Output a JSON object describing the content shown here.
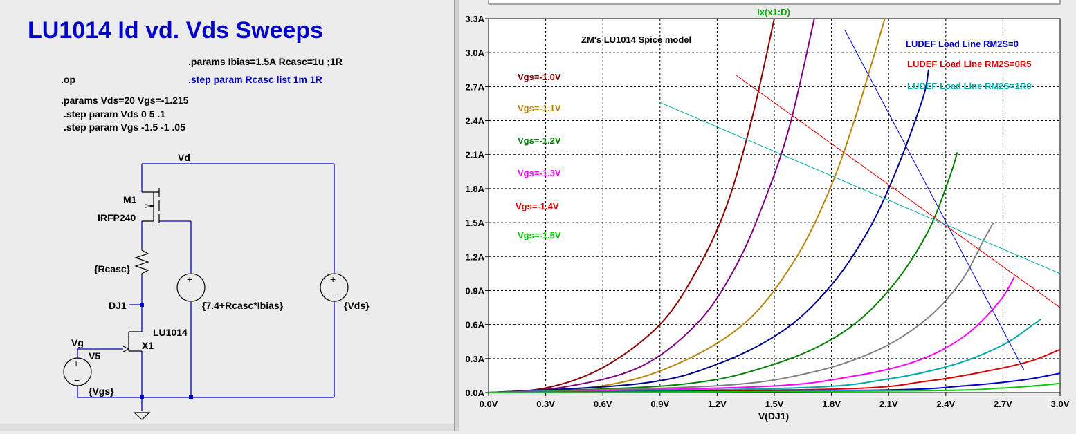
{
  "schematic": {
    "title": "LU1014 Id vd. Vds Sweeps",
    "title_color": "#0000cc",
    "directives": {
      "params_ibias": ".params Ibias=1.5A Rcasc=1u ;1R",
      "op": ".op",
      "step_rcasc": ".step param Rcasc list 1m 1R",
      "params_vds": ".params Vds=20 Vgs=-1.215",
      "step_vds": ".step param Vds 0 5 .1",
      "step_vgs": ".step param Vgs -1.5 -1 .05"
    },
    "labels": {
      "vd_net": "Vd",
      "m1_name": "M1",
      "m1_model": "IRFP240",
      "rcasc": "{Rcasc}",
      "dj1_net": "DJ1",
      "x1_model": "LU1014",
      "x1_name": "X1",
      "vg_net": "Vg",
      "v5_name": "V5",
      "v5_value": "{Vgs}",
      "vsrc_mid": "{7.4+Rcasc*Ibias}",
      "vsrc_right": "{Vds}",
      "plus_sign": "+",
      "minus_sign": "−"
    },
    "wire_color": "#0000cc"
  },
  "plot": {
    "trace_label": "Ix(x1:D)",
    "trace_label_color": "#00aa00",
    "model_title": "ZM's LU1014 Spice model",
    "x_axis_label": "V(DJ1)",
    "legend": [
      {
        "text": "LUDEF Load Line RM2S=0",
        "color": "#0000cc"
      },
      {
        "text": "LUDEF Load Line RM2S=0R5",
        "color": "#dd0000"
      },
      {
        "text": "LUDEF Load Line RM2S=1R0",
        "color": "#00aaaa"
      }
    ],
    "vgs_labels": [
      {
        "text": "Vgs=-1.0V",
        "color": "#8b0000"
      },
      {
        "text": "Vgs=-1.1V",
        "color": "#b8860b"
      },
      {
        "text": "Vgs=-1.2V",
        "color": "#008000"
      },
      {
        "text": "Vgs=-1.3V",
        "color": "#ff00ff"
      },
      {
        "text": "Vgs=-1.4V",
        "color": "#dd0000"
      },
      {
        "text": "Vgs=-1.5V",
        "color": "#00cc00"
      }
    ]
  },
  "chart_data": {
    "type": "line",
    "title": "ZM's LU1014 Spice model",
    "xlabel": "V(DJ1)",
    "ylabel": "",
    "xlim": [
      0,
      3.0
    ],
    "ylim": [
      0,
      3.3
    ],
    "x_ticks": [
      "0.0V",
      "0.3V",
      "0.6V",
      "0.9V",
      "1.2V",
      "1.5V",
      "1.8V",
      "2.1V",
      "2.4V",
      "2.7V",
      "3.0V"
    ],
    "y_ticks": [
      "0.0A",
      "0.3A",
      "0.6A",
      "0.9A",
      "1.2A",
      "1.5A",
      "1.8A",
      "2.1A",
      "2.4A",
      "2.7A",
      "3.0A",
      "3.3A"
    ],
    "grid": true,
    "series": [
      {
        "color": "#8b0000",
        "points": [
          [
            0,
            0
          ],
          [
            0.3,
            0.04
          ],
          [
            0.6,
            0.22
          ],
          [
            0.9,
            0.6
          ],
          [
            1.1,
            1.1
          ],
          [
            1.25,
            1.65
          ],
          [
            1.38,
            2.4
          ],
          [
            1.5,
            3.3
          ]
        ]
      },
      {
        "color": "#800080",
        "points": [
          [
            0,
            0
          ],
          [
            0.4,
            0.05
          ],
          [
            0.8,
            0.23
          ],
          [
            1.1,
            0.62
          ],
          [
            1.3,
            1.12
          ],
          [
            1.45,
            1.7
          ],
          [
            1.58,
            2.35
          ],
          [
            1.71,
            3.3
          ]
        ]
      },
      {
        "color": "#b8860b",
        "points": [
          [
            0,
            0
          ],
          [
            0.6,
            0.06
          ],
          [
            1.0,
            0.26
          ],
          [
            1.35,
            0.62
          ],
          [
            1.6,
            1.15
          ],
          [
            1.78,
            1.75
          ],
          [
            1.92,
            2.4
          ],
          [
            2.08,
            3.3
          ]
        ]
      },
      {
        "color": "#00008b",
        "points": [
          [
            0,
            0
          ],
          [
            0.8,
            0.08
          ],
          [
            1.2,
            0.25
          ],
          [
            1.55,
            0.55
          ],
          [
            1.8,
            0.95
          ],
          [
            2.0,
            1.45
          ],
          [
            2.15,
            2.0
          ],
          [
            2.28,
            2.6
          ],
          [
            2.31,
            2.85
          ]
        ]
      },
      {
        "color": "#008000",
        "points": [
          [
            0,
            0
          ],
          [
            1.0,
            0.07
          ],
          [
            1.5,
            0.25
          ],
          [
            1.85,
            0.52
          ],
          [
            2.1,
            0.9
          ],
          [
            2.3,
            1.4
          ],
          [
            2.42,
            1.9
          ],
          [
            2.46,
            2.12
          ]
        ]
      },
      {
        "color": "#808080",
        "points": [
          [
            0,
            0
          ],
          [
            1.2,
            0.06
          ],
          [
            1.7,
            0.18
          ],
          [
            2.05,
            0.38
          ],
          [
            2.3,
            0.65
          ],
          [
            2.48,
            0.98
          ],
          [
            2.6,
            1.35
          ],
          [
            2.65,
            1.5
          ]
        ]
      },
      {
        "color": "#ff00ff",
        "points": [
          [
            0,
            0
          ],
          [
            1.4,
            0.05
          ],
          [
            1.9,
            0.14
          ],
          [
            2.25,
            0.28
          ],
          [
            2.5,
            0.5
          ],
          [
            2.68,
            0.8
          ],
          [
            2.76,
            1.02
          ]
        ]
      },
      {
        "color": "#00aaaa",
        "points": [
          [
            0,
            0
          ],
          [
            1.6,
            0.04
          ],
          [
            2.1,
            0.12
          ],
          [
            2.45,
            0.25
          ],
          [
            2.7,
            0.42
          ],
          [
            2.86,
            0.6
          ],
          [
            2.9,
            0.65
          ]
        ]
      },
      {
        "color": "#dd0000",
        "points": [
          [
            0,
            0
          ],
          [
            1.8,
            0.03
          ],
          [
            2.3,
            0.1
          ],
          [
            2.65,
            0.2
          ],
          [
            2.85,
            0.28
          ],
          [
            3.0,
            0.38
          ]
        ]
      },
      {
        "color": "#0000cc",
        "points": [
          [
            0,
            0
          ],
          [
            2.0,
            0.02
          ],
          [
            2.5,
            0.06
          ],
          [
            2.8,
            0.11
          ],
          [
            3.0,
            0.17
          ]
        ]
      },
      {
        "color": "#00cc00",
        "points": [
          [
            0,
            0
          ],
          [
            2.2,
            0.015
          ],
          [
            2.7,
            0.04
          ],
          [
            3.0,
            0.08
          ]
        ]
      }
    ],
    "load_lines": [
      {
        "name": "LUDEF Load Line RM2S=0",
        "color": "#0000cc",
        "points": [
          [
            1.87,
            3.2
          ],
          [
            2.81,
            0.2
          ]
        ]
      },
      {
        "name": "LUDEF Load Line RM2S=0R5",
        "color": "#dd0000",
        "points": [
          [
            1.3,
            2.8
          ],
          [
            3.0,
            0.75
          ]
        ]
      },
      {
        "name": "LUDEF Load Line RM2S=1R0",
        "color": "#00aaaa",
        "points": [
          [
            0.9,
            2.56
          ],
          [
            3.0,
            1.05
          ]
        ]
      }
    ]
  }
}
